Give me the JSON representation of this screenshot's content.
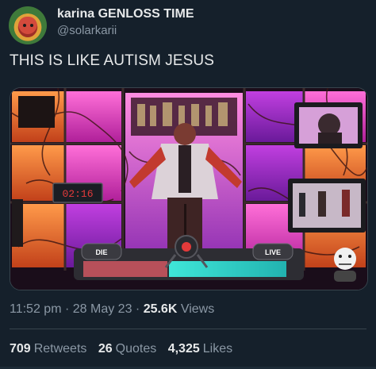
{
  "author": {
    "display_name": "karina GENLOSS TIME",
    "handle": "@solarkarii"
  },
  "tweet": {
    "text": "THIS IS LIKE AUTISM JESUS"
  },
  "media": {
    "timer": "02:16",
    "left_button_label": "DIE",
    "right_button_label": "LIVE"
  },
  "meta": {
    "time": "11:52 pm",
    "separator": " · ",
    "date": "28 May 23",
    "views_count": "25.6K",
    "views_label": "Views"
  },
  "stats": {
    "retweets_count": "709",
    "retweets_label": "Retweets",
    "quotes_count": "26",
    "quotes_label": "Quotes",
    "likes_count": "4,325",
    "likes_label": "Likes"
  },
  "colors": {
    "background": "#15202b",
    "primary_text": "#e7e9ea",
    "secondary_text": "#8b98a5",
    "border": "#38444d"
  }
}
